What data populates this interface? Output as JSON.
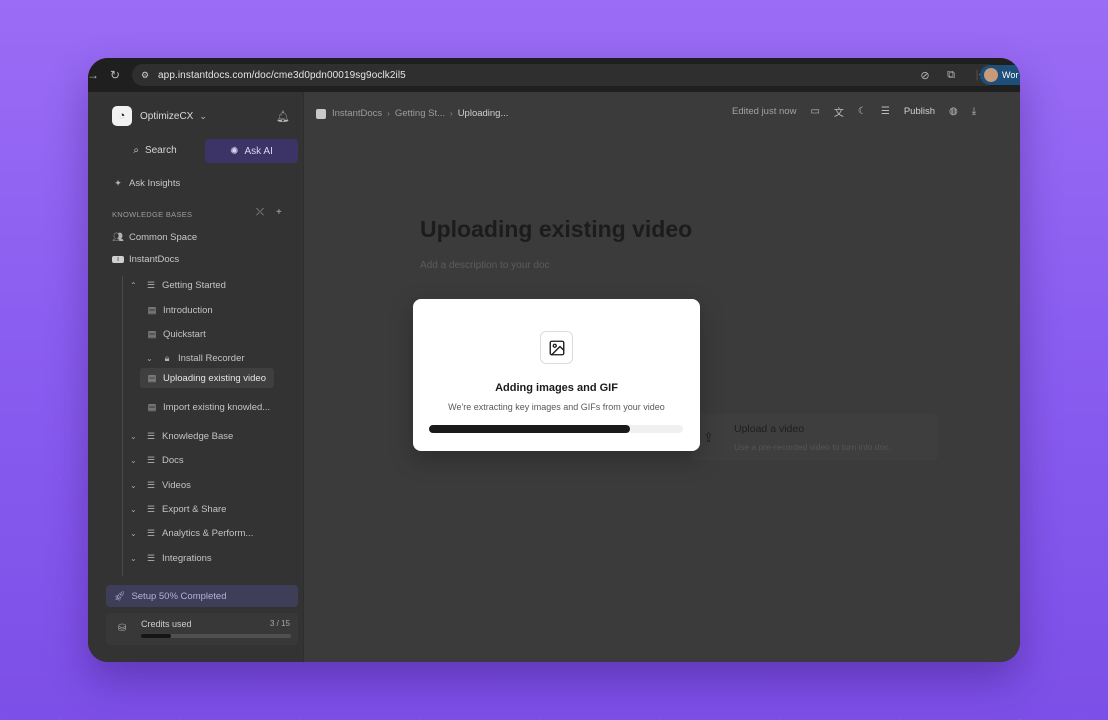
{
  "browser": {
    "url": "app.instantdocs.com/doc/cme3d0pdn00019sg9oclk2il5",
    "profile_label": "Wor"
  },
  "sidebar": {
    "org_name": "OptimizeCX",
    "search_label": "Search",
    "ask_ai_label": "Ask AI",
    "ask_insights_label": "Ask Insights",
    "kb_header": "KNOWLEDGE BASES",
    "common_space": "Common Space",
    "workspace": "InstantDocs",
    "tree": {
      "getting_started": "Getting Started",
      "introduction": "Introduction",
      "quickstart": "Quickstart",
      "install_recorder": "Install Recorder",
      "uploading_video": "Uploading existing video",
      "import_knowledge": "Import existing knowled...",
      "knowledge_base": "Knowledge Base",
      "docs": "Docs",
      "videos": "Videos",
      "export_share": "Export & Share",
      "analytics": "Analytics & Perform...",
      "integrations": "Integrations"
    },
    "setup_label": "Setup 50% Completed",
    "credits_label": "Credits used",
    "credits_count": "3 / 15",
    "credits_fraction": 0.2
  },
  "header": {
    "crumb_root": "InstantDocs",
    "crumb_mid": "Getting St...",
    "crumb_current": "Uploading...",
    "edited": "Edited just now",
    "publish": "Publish"
  },
  "doc": {
    "title": "Uploading existing video",
    "description": "Add a description to your doc",
    "upload_title": "Upload a video",
    "upload_desc": "Use a pre-recorded video to turn into doc."
  },
  "modal": {
    "title": "Adding images and GIF",
    "description": "We're extracting key images and GIFs from your video",
    "progress": 0.79
  }
}
